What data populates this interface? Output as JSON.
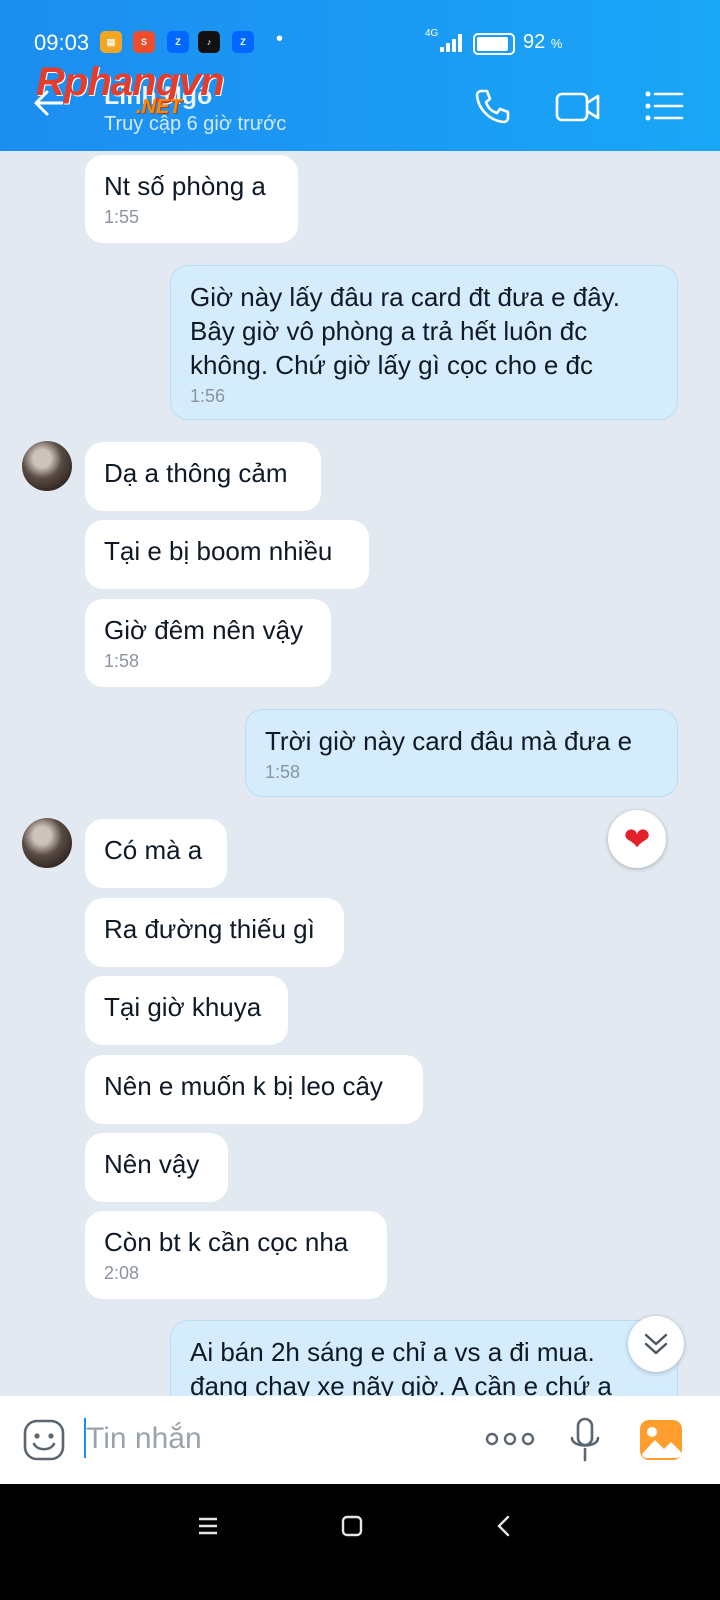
{
  "status_bar": {
    "time": "09:03",
    "network": "4G",
    "battery": "92",
    "battery_unit": "%"
  },
  "header": {
    "contact_name": "Linh Ngô",
    "last_seen": "Truy cập 6 giờ trước",
    "watermark": "Rphangvn",
    "watermark_sub": ".NET"
  },
  "messages": [
    {
      "side": "in",
      "text": "Nt số phòng a",
      "time": "1:55"
    },
    {
      "side": "out",
      "text": "Giờ này lấy đâu ra card đt đưa e đây.\nBây giờ vô phòng a trả hết luôn đc\nkhông. Chứ giờ lấy gì cọc cho e đc",
      "time": "1:56"
    },
    {
      "side": "in",
      "text": "Dạ a thông cảm",
      "time": ""
    },
    {
      "side": "in",
      "text": "Tại e bị boom nhiều",
      "time": ""
    },
    {
      "side": "in",
      "text": "Giờ đêm nên vậy",
      "time": "1:58"
    },
    {
      "side": "out",
      "text": "Trời giờ này card đâu mà đưa e",
      "time": "1:58"
    },
    {
      "side": "in",
      "text": "Có mà a",
      "time": ""
    },
    {
      "side": "in",
      "text": "Ra đường thiếu gì",
      "time": ""
    },
    {
      "side": "in",
      "text": "Tại giờ khuya",
      "time": ""
    },
    {
      "side": "in",
      "text": "Nên e muốn k bị leo cây",
      "time": ""
    },
    {
      "side": "in",
      "text": "Nên vậy",
      "time": ""
    },
    {
      "side": "in",
      "text": "Còn bt k cần cọc nha",
      "time": "2:08"
    },
    {
      "side": "out",
      "text": "Ai bán 2h sáng e chỉ a vs a đi mua.\nđang chạy xe nãy giờ. A cần e chứ a",
      "time": ""
    }
  ],
  "reaction": {
    "icon": "heart-icon",
    "color": "#e3202c"
  },
  "composer": {
    "placeholder": "Tin nhắn"
  },
  "colors": {
    "header": "#1c8df0",
    "outgoing_bubble": "#d5ecfd",
    "chat_bg": "#e2e9f1"
  }
}
